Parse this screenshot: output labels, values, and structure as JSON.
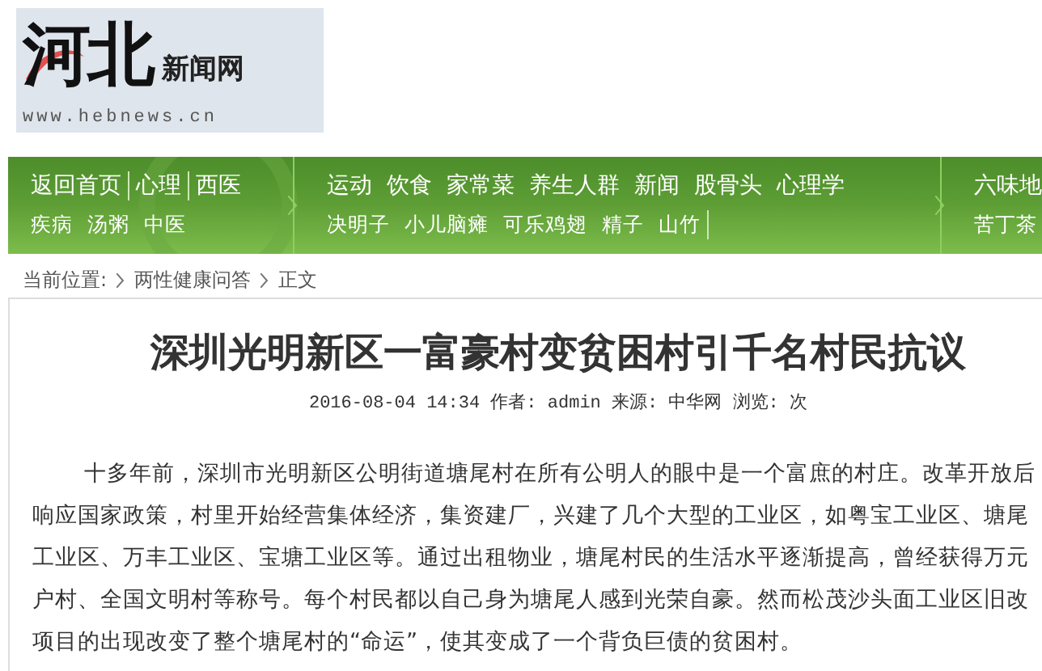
{
  "logo": {
    "mark": "河北",
    "name": "新闻网",
    "url": "www.hebnews.cn"
  },
  "nav": {
    "groups": [
      {
        "top": [
          {
            "label": "返回首页",
            "divider": true
          },
          {
            "label": "心理",
            "divider": true
          },
          {
            "label": "西医",
            "divider": false
          }
        ],
        "bottom": [
          {
            "label": "疾病",
            "divider": false
          },
          {
            "label": "汤粥",
            "divider": false
          },
          {
            "label": "中医",
            "divider": false
          }
        ]
      },
      {
        "top": [
          {
            "label": "运动",
            "divider": false
          },
          {
            "label": "饮食",
            "divider": false
          },
          {
            "label": "家常菜",
            "divider": false
          },
          {
            "label": "养生人群",
            "divider": false
          },
          {
            "label": "新闻",
            "divider": false
          },
          {
            "label": "股骨头",
            "divider": false
          },
          {
            "label": "心理学",
            "divider": false
          }
        ],
        "bottom": [
          {
            "label": "决明子",
            "divider": false
          },
          {
            "label": "小儿脑瘫",
            "divider": false
          },
          {
            "label": "可乐鸡翅",
            "divider": false
          },
          {
            "label": "精子",
            "divider": false
          },
          {
            "label": "山竹",
            "divider": true
          }
        ]
      },
      {
        "top": [
          {
            "label": "六味地"
          }
        ],
        "bottom": [
          {
            "label": "苦丁茶"
          }
        ]
      }
    ]
  },
  "breadcrumb": {
    "label": "当前位置:",
    "items": [
      "两性健康问答",
      "正文"
    ]
  },
  "article": {
    "title": "深圳光明新区一富豪村变贫困村引千名村民抗议",
    "meta": "2016-08-04 14:34 作者: admin 来源: 中华网 浏览:  次",
    "lines": [
      "十多年前，深圳市光明新区公明街道塘尾村在所有公明人的眼中是一个富庶的村庄。改革开放后",
      "响应国家政策，村里开始经营集体经济，集资建厂，兴建了几个大型的工业区，如粤宝工业区、塘尾",
      "工业区、万丰工业区、宝塘工业区等。通过出租物业，塘尾村民的生活水平逐渐提高，曾经获得万元",
      "户村、全国文明村等称号。每个村民都以自己身为塘尾人感到光荣自豪。然而松茂沙头面工业区旧改",
      "项目的出现改变了整个塘尾村的“命运”，使其变成了一个背负巨债的贫困村。"
    ]
  }
}
